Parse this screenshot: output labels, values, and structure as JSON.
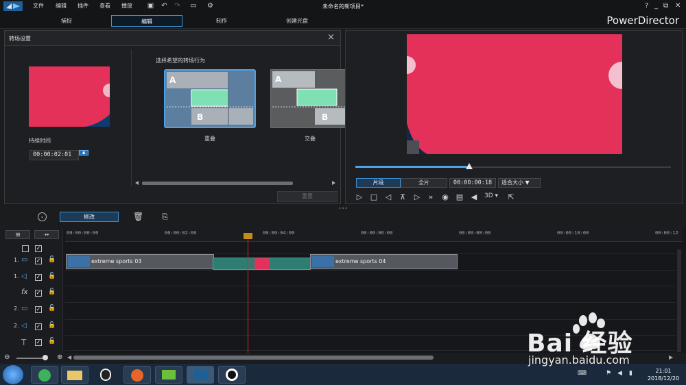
{
  "menu": [
    "文件",
    "编辑",
    "插件",
    "查看",
    "播放"
  ],
  "window_title": "未命名的新项目*",
  "window_controls": {
    "help": "?",
    "min": "_",
    "restore": "⧉",
    "close": "✕"
  },
  "modes": [
    {
      "label": "捕捉",
      "active": false
    },
    {
      "label": "编辑",
      "active": true
    },
    {
      "label": "制作",
      "active": false
    },
    {
      "label": "创建光盘",
      "active": false
    }
  ],
  "brand": "PowerDirector",
  "dialog": {
    "title": "转场设置",
    "duration_label": "持续时间",
    "duration_value": "00:00:02:01",
    "choose_label": "选择希望的转场行为",
    "options": [
      {
        "label": "重叠",
        "selected": true,
        "a": "A",
        "b": "B"
      },
      {
        "label": "交叠",
        "selected": false,
        "a": "A",
        "b": "B"
      }
    ],
    "ok_button": "重置"
  },
  "preview": {
    "clip_tab": "片段",
    "full_tab": "全片",
    "timecode": "00:00:00:18",
    "fit": "适合大小",
    "three_d": "3D",
    "scrub_progress": 0.36
  },
  "toolbar": {
    "modify": "修改"
  },
  "timeline": {
    "ticks": [
      "00:00:00:00",
      "00:00:02:00",
      "00:00:04:00",
      "00:00:06:00",
      "00:00:08:00",
      "00:00:10:00",
      "00:00:12"
    ],
    "tracks": [
      {
        "num": "",
        "icon": "",
        "name": "master-row"
      },
      {
        "num": "1.",
        "icon": "video-track-icon"
      },
      {
        "num": "1.",
        "icon": "audio-track-icon"
      },
      {
        "num": "",
        "icon": "fx-track-icon"
      },
      {
        "num": "2.",
        "icon": "video-track-icon"
      },
      {
        "num": "2.",
        "icon": "audio-track-icon"
      },
      {
        "num": "",
        "icon": "title-track-icon"
      }
    ],
    "clips": [
      {
        "name": "extreme sports 03"
      },
      {
        "name": "extreme sports 04"
      }
    ]
  },
  "watermark": {
    "brand": "Bai 经验",
    "url": "jingyan.baidu.com"
  },
  "clock": {
    "time": "21:01",
    "date": "2018/12/20"
  },
  "colors": {
    "accent": "#3b8fd4",
    "preview_pink": "#e4315a",
    "transition": "#2e7d73",
    "playhead": "#d3263a"
  }
}
